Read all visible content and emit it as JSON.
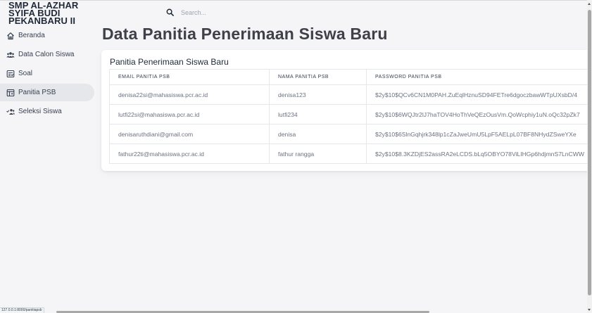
{
  "brand": {
    "line1": "SMP AL-AZHAR",
    "line2": "SYIFA BUDI",
    "line3": "PEKANBARU II"
  },
  "search": {
    "placeholder": "Search..."
  },
  "sidebar": {
    "items": [
      {
        "label": "Beranda",
        "icon": "home-icon",
        "active": false
      },
      {
        "label": "Data Calon Siswa",
        "icon": "users-icon",
        "active": false
      },
      {
        "label": "Soal",
        "icon": "document-list-icon",
        "active": false
      },
      {
        "label": "Panitia PSB",
        "icon": "committee-table-icon",
        "active": true
      },
      {
        "label": "Seleksi Siswa",
        "icon": "user-group-select-icon",
        "active": false
      }
    ]
  },
  "page": {
    "title": "Data Panitia Penerimaan Siswa Baru"
  },
  "card": {
    "title": "Panitia Penerimaan Siswa Baru",
    "columns": [
      "EMAIL PANITIA PSB",
      "NAMA PANITIA PSB",
      "PASSWORD PANITIA PSB"
    ],
    "rows": [
      [
        "denisa22si@mahasiswa.pcr.ac.id",
        "denisa123",
        "$2y$10$QCv6CN1M0PAH.ZuEqlHznuSD94FETre6dgoczbawWTpUXsbD/4"
      ],
      [
        "lutfi22si@mahasiswa.pcr.ac.id",
        "lutfi234",
        "$2y$10$6WQJtr2lJ7haTOV4HoThVeQEzOusVm.QoWcphiy1uN.oQc32pZk7"
      ],
      [
        "denisaruthdiani@gmail.com",
        "denisa",
        "$2y$10$6SlnGqhjrk348lp1cZaJweUmU5LpF5AELpL07BF8NHydZSweYXe"
      ],
      [
        "fathur22ti@mahasiswa.pcr.ac.id",
        "fathur rangga",
        "$2y$10$8.3KZDjES2assRA2eLCDS.bLq5OBYO78ViLIHGp6hdjmnS7LnCWW"
      ]
    ]
  },
  "statusbar": {
    "url": "127.0.0.1:8000/panitiapsb"
  },
  "colors": {
    "background": "#f5f5f7",
    "active_item": "#e5e7eb",
    "card": "#ffffff"
  }
}
